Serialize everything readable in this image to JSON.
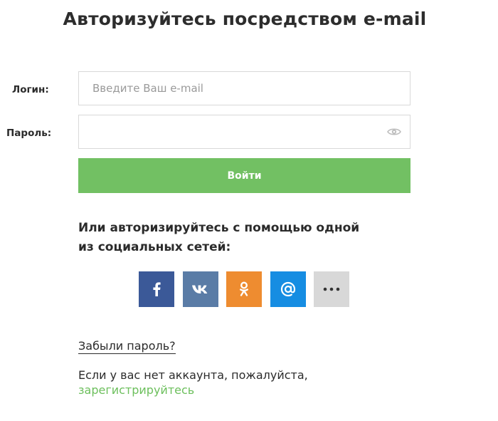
{
  "page": {
    "title": "Авторизуйтесь посредством e-mail"
  },
  "form": {
    "login_label": "Логин:",
    "login_placeholder": "Введите Ваш e-mail",
    "login_value": "",
    "password_label": "Пароль:",
    "password_value": "",
    "submit_label": "Войти"
  },
  "social": {
    "heading_line1": "Или авторизируйтесь с помощью одной",
    "heading_line2": "из социальных сетей:",
    "buttons": [
      {
        "icon": "facebook-icon",
        "color": "#3b5998"
      },
      {
        "icon": "vk-icon",
        "color": "#5a7ca6"
      },
      {
        "icon": "odnoklassniki-icon",
        "color": "#ee8c30"
      },
      {
        "icon": "mail-at-icon",
        "color": "#168de2"
      },
      {
        "icon": "more-dots-icon",
        "color": "#d8d8d8"
      }
    ]
  },
  "links": {
    "forgot_password": "Забыли пароль?",
    "no_account_text": "Если у вас нет аккаунта, пожалуйста,",
    "register": "зарегистрируйтесь"
  },
  "colors": {
    "accent_green": "#72c063",
    "link_green": "#6cbf5c"
  }
}
